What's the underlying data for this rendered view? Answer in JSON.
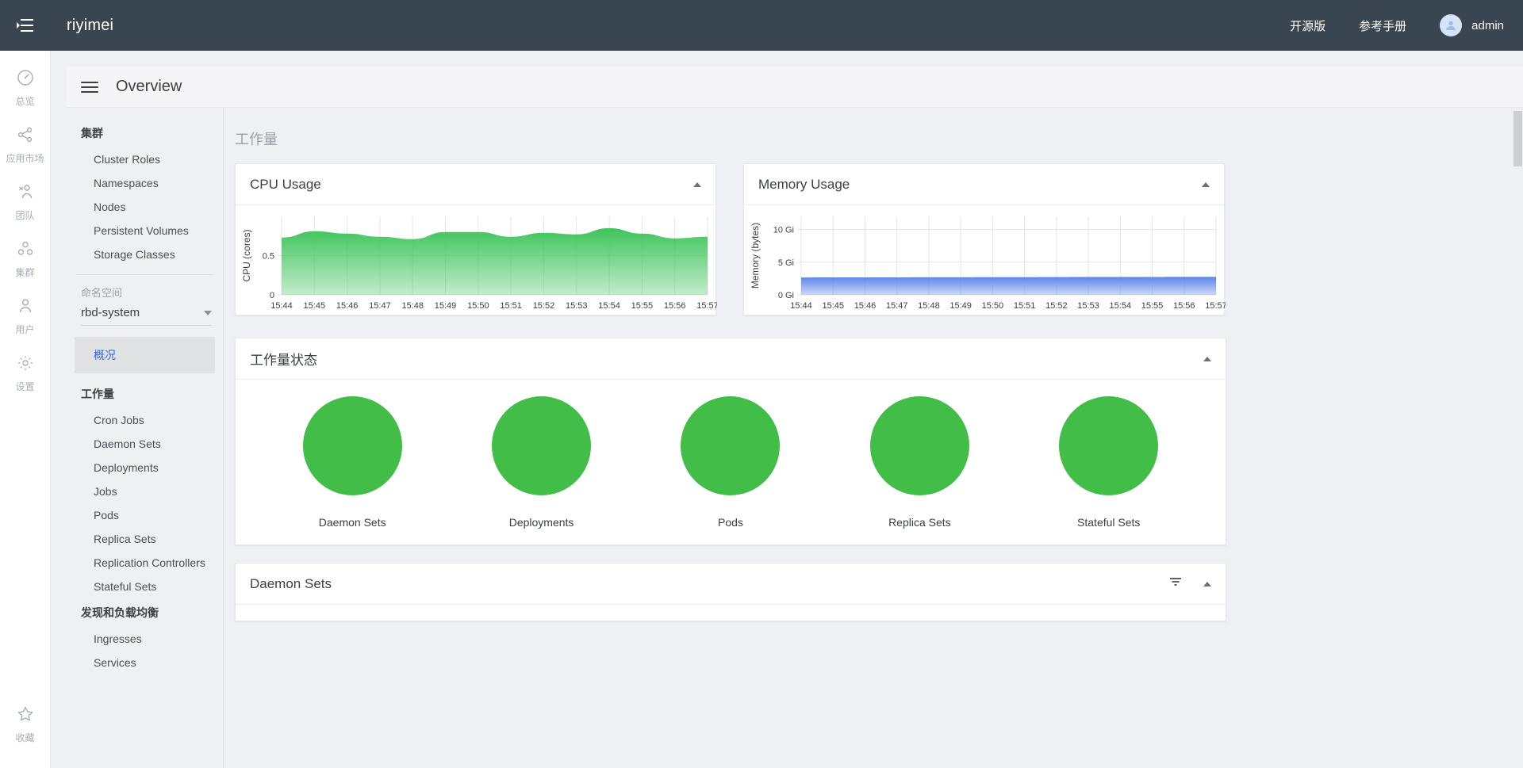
{
  "topbar": {
    "menu_icon": "menu-collapse-icon",
    "brand": "riyimei",
    "links": [
      {
        "label": "开源版",
        "name": "opensource-link"
      },
      {
        "label": "参考手册",
        "name": "reference-manual-link"
      }
    ],
    "avatar_icon": "user-avatar-icon",
    "user": "admin"
  },
  "rail": {
    "items": [
      {
        "label": "总览",
        "icon": "dashboard-icon"
      },
      {
        "label": "应用市场",
        "icon": "share-icon"
      },
      {
        "label": "团队",
        "icon": "team-icon"
      },
      {
        "label": "集群",
        "icon": "cluster-icon"
      },
      {
        "label": "用户",
        "icon": "user-icon"
      },
      {
        "label": "设置",
        "icon": "gear-icon"
      }
    ],
    "bottom": {
      "label": "收藏",
      "icon": "star-icon"
    }
  },
  "page": {
    "title": "Overview",
    "menu_icon": "hamburger-icon"
  },
  "sidebar": {
    "cluster_group": "集群",
    "cluster_items": [
      "Cluster Roles",
      "Namespaces",
      "Nodes",
      "Persistent Volumes",
      "Storage Classes"
    ],
    "namespace_label": "命名空间",
    "namespace_value": "rbd-system",
    "active_item": "概况",
    "workload_group": "工作量",
    "workload_items": [
      "Cron Jobs",
      "Daemon Sets",
      "Deployments",
      "Jobs",
      "Pods",
      "Replica Sets",
      "Replication Controllers",
      "Stateful Sets"
    ],
    "discovery_group": "发现和负载均衡",
    "discovery_items": [
      "Ingresses",
      "Services"
    ]
  },
  "main": {
    "section_heading": "工作量",
    "cpu_card_title": "CPU Usage",
    "memory_card_title": "Memory Usage",
    "status_card_title": "工作量状态",
    "daemonsets_card_title": "Daemon Sets",
    "collapse_icon": "chevron-up-icon",
    "filter_icon": "filter-icon"
  },
  "colors": {
    "topbar_bg": "#3a4552",
    "accent_blue": "#3367d6",
    "status_green": "#41bd48",
    "cpu_green": "#3fc45c",
    "memory_blue": "#5c85e8"
  },
  "workload_status": [
    {
      "label": "Daemon Sets",
      "percent": 100,
      "color": "#41bd48"
    },
    {
      "label": "Deployments",
      "percent": 100,
      "color": "#41bd48"
    },
    {
      "label": "Pods",
      "percent": 100,
      "color": "#41bd48"
    },
    {
      "label": "Replica Sets",
      "percent": 100,
      "color": "#41bd48"
    },
    {
      "label": "Stateful Sets",
      "percent": 100,
      "color": "#41bd48"
    }
  ],
  "chart_data": [
    {
      "type": "area",
      "title": "CPU Usage",
      "xlabel": "",
      "ylabel": "CPU (cores)",
      "ylim": [
        0,
        1.0
      ],
      "yticks": [
        0,
        0.5
      ],
      "ytick_labels": [
        "0",
        "0.5"
      ],
      "grid": true,
      "legend": "none",
      "color": "#3fc45c",
      "x": [
        "15:44",
        "15:45",
        "15:46",
        "15:47",
        "15:48",
        "15:49",
        "15:50",
        "15:51",
        "15:52",
        "15:53",
        "15:54",
        "15:55",
        "15:56",
        "15:57"
      ],
      "values": [
        0.73,
        0.81,
        0.78,
        0.74,
        0.71,
        0.8,
        0.8,
        0.74,
        0.79,
        0.77,
        0.85,
        0.78,
        0.72,
        0.74
      ]
    },
    {
      "type": "area",
      "title": "Memory Usage",
      "xlabel": "",
      "ylabel": "Memory (bytes)",
      "ylim": [
        0,
        12
      ],
      "yticks": [
        0,
        5,
        10
      ],
      "ytick_labels": [
        "0 Gi",
        "5 Gi",
        "10 Gi"
      ],
      "grid": true,
      "legend": "none",
      "color": "#5c85e8",
      "x": [
        "15:44",
        "15:45",
        "15:46",
        "15:47",
        "15:48",
        "15:49",
        "15:50",
        "15:51",
        "15:52",
        "15:53",
        "15:54",
        "15:55",
        "15:56",
        "15:57"
      ],
      "values": [
        2.65,
        2.66,
        2.67,
        2.67,
        2.68,
        2.68,
        2.69,
        2.7,
        2.71,
        2.72,
        2.72,
        2.73,
        2.74,
        2.74
      ]
    }
  ]
}
